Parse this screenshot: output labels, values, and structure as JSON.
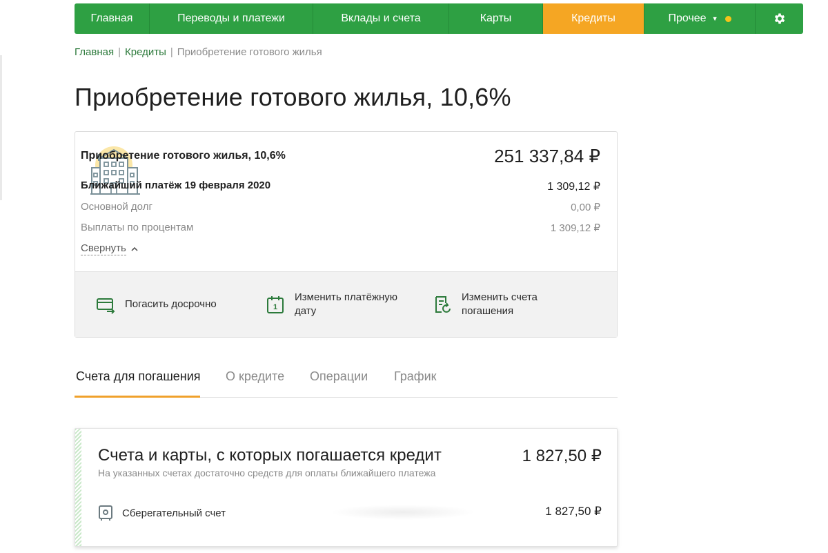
{
  "nav": {
    "items": [
      {
        "label": "Главная",
        "active": false
      },
      {
        "label": "Переводы и платежи",
        "active": false
      },
      {
        "label": "Вклады и счета",
        "active": false
      },
      {
        "label": "Карты",
        "active": false
      },
      {
        "label": "Кредиты",
        "active": true
      },
      {
        "label": "Прочее",
        "active": false
      }
    ],
    "settings_icon": "gear-icon",
    "brand_color": "#2ea043",
    "active_color": "#f5a623"
  },
  "breadcrumb": {
    "items": [
      "Главная",
      "Кредиты",
      "Приобретение готового жилья"
    ],
    "separator": "|"
  },
  "page": {
    "title": "Приобретение готового жилья, 10,6%"
  },
  "loan": {
    "icon": "building-icon",
    "name": "Приобретение готового жилья, 10,6%",
    "total": "251 337,84 ₽",
    "next_payment_label": "Ближайший платёж 19 февраля 2020",
    "next_payment_value": "1 309,12 ₽",
    "principal_label": "Основной долг",
    "principal_value": "0,00 ₽",
    "interest_label": "Выплаты по процентам",
    "interest_value": "1 309,12 ₽",
    "collapse_label": "Свернуть",
    "actions": [
      {
        "label": "Погасить досрочно",
        "icon": "card-repay-icon"
      },
      {
        "label": "Изменить платёжную дату",
        "icon": "calendar-icon"
      },
      {
        "label": "Изменить счета погашения",
        "icon": "document-refresh-icon"
      }
    ]
  },
  "tabs": [
    {
      "label": "Счета для погашения",
      "active": true
    },
    {
      "label": "О кредите",
      "active": false
    },
    {
      "label": "Операции",
      "active": false
    },
    {
      "label": "График",
      "active": false
    }
  ],
  "accounts": {
    "title": "Счета и карты, с которых погашается кредит",
    "total": "1 827,50 ₽",
    "subtitle": "На указанных счетах достаточно средств для оплаты ближайшего платежа",
    "items": [
      {
        "name": "Сберегательный счет",
        "value": "1 827,50 ₽",
        "icon": "safe-icon"
      }
    ]
  }
}
